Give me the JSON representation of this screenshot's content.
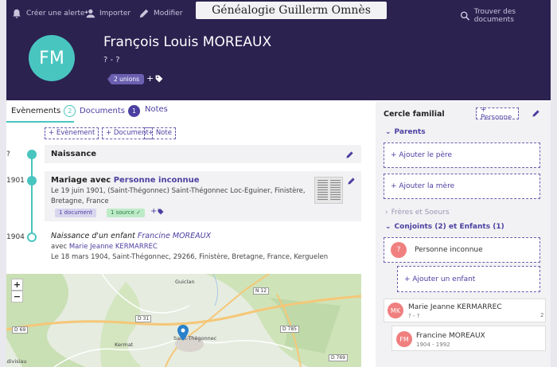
{
  "topbar": {
    "create_alert": "Créer une alerte",
    "import": "Importer",
    "modify": "Modifier",
    "site_title": "Généalogie Guillerm Omnès",
    "find_documents": "Trouver des documents"
  },
  "person": {
    "initials": "FM",
    "name": "François Louis MOREAUX",
    "dates": "? - ?",
    "unions_badge": "2 unions",
    "add_tag": "+"
  },
  "tabs": [
    {
      "label": "Evènements",
      "count": "2"
    },
    {
      "label": "Documents",
      "count": "1"
    },
    {
      "label": "Notes"
    }
  ],
  "add_buttons": {
    "event": "+ Evènement",
    "document": "+ Document",
    "note": "+ Note"
  },
  "timeline": [
    {
      "year": "?",
      "title": "Naissance"
    },
    {
      "year": "1901",
      "title_prefix": "Mariage avec ",
      "title_link": "Personne inconnue",
      "text": "Le 19 juin 1901, (Saint-Thégonnec) Saint-Thégonnec Loc-Eguiner, Finistère, Bretagne, France",
      "doc_chip": "1 document",
      "source_chip": "1 source"
    },
    {
      "year": "1904",
      "title_prefix": "Naissance d'un enfant ",
      "title_link": "Francine MOREAUX",
      "with_prefix": "avec ",
      "with_link": "Marie Jeanne KERMARREC",
      "text": "Le 18 mars 1904, Saint-Thégonnec, 29266, Finistère, Bretagne, France, Kerguelen"
    }
  ],
  "map": {
    "zoom_in": "+",
    "zoom_out": "−",
    "labels": {
      "guiclan": "Guiclan",
      "saint_thegonnec": "Saint-Thégonnec",
      "kermat": "Kermat",
      "divisiau": "Ldivisiau"
    },
    "roads": {
      "n12": "N 12",
      "d31": "D 31",
      "d69": "D 69",
      "d785": "D 785",
      "d769": "D 769"
    }
  },
  "family": {
    "title": "Cercle familial",
    "add_person": "+ Personne",
    "parents_label": "Parents",
    "add_father": "+ Ajouter le père",
    "add_mother": "+ Ajouter la mère",
    "siblings_label": "Frères et Soeurs",
    "spouses_label": "Conjoints (2) et Enfants (1)",
    "unknown_person": "Personne inconnue",
    "unknown_initial": "?",
    "add_child": "+ Ajouter un enfant",
    "spouse": {
      "initials": "MK",
      "name": "Marie Jeanne KERMARREC",
      "dates": "? - ?",
      "count": "2"
    },
    "child": {
      "initials": "FM",
      "name": "Francine MOREAUX",
      "dates": "1904 - 1992"
    }
  },
  "colors": {
    "header": "#2b2250",
    "accent": "#49c5c0",
    "link": "#4b3fa0",
    "avatar_pink": "#f07f7f"
  }
}
